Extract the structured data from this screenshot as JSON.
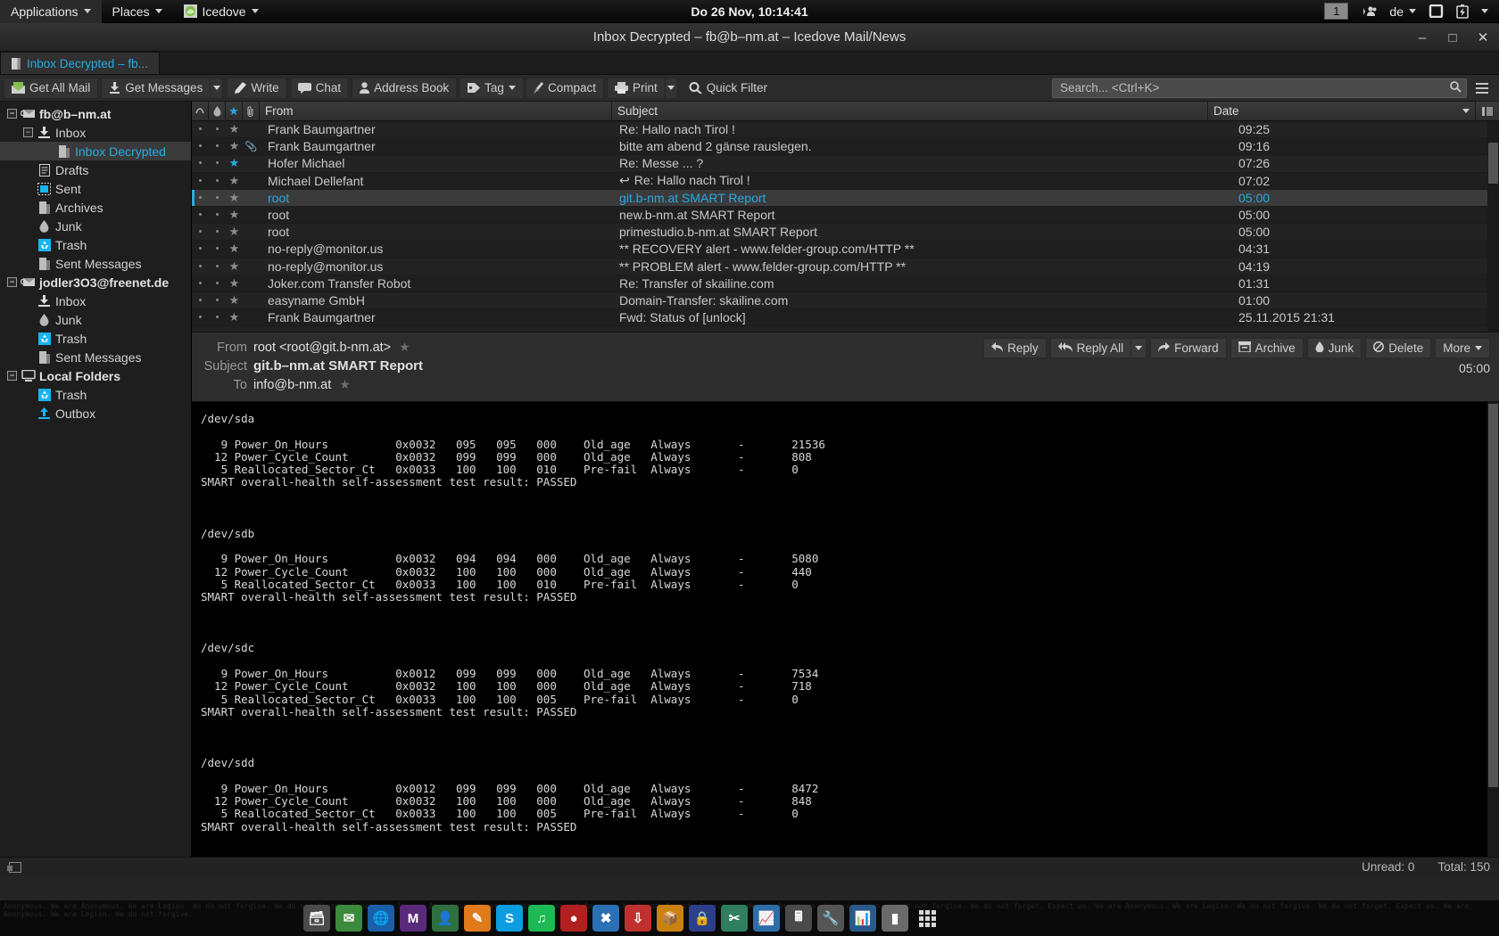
{
  "panel": {
    "applications": "Applications",
    "places": "Places",
    "app_name": "Icedove",
    "clock": "Do 26 Nov, 10:14:41",
    "workspace": "1",
    "keyboard": "de",
    "icons": [
      "users-icon",
      "keyboard-icon",
      "display-icon",
      "battery-icon"
    ]
  },
  "window": {
    "title": "Inbox Decrypted – fb@b–nm.at – Icedove Mail/News",
    "minimize": "–",
    "maximize": "□",
    "close": "✕"
  },
  "tab": {
    "label": "Inbox Decrypted – fb..."
  },
  "toolbar": {
    "get_all_mail": "Get All Mail",
    "get_messages": "Get Messages",
    "write": "Write",
    "chat": "Chat",
    "address_book": "Address Book",
    "tag": "Tag",
    "compact": "Compact",
    "print": "Print",
    "quick_filter": "Quick Filter",
    "search_placeholder": "Search... <Ctrl+K>",
    "search_value": ""
  },
  "sidebar": {
    "items": [
      {
        "label": "fb@b–nm.at",
        "level": 0,
        "icon": "account-icon",
        "twisty": "–",
        "account": true,
        "selected": false
      },
      {
        "label": "Inbox",
        "level": 1,
        "icon": "inbox-icon",
        "twisty": "–",
        "account": false,
        "selected": false
      },
      {
        "label": "Inbox Decrypted",
        "level": 2,
        "icon": "folder-icon",
        "twisty": "",
        "account": false,
        "selected": true
      },
      {
        "label": "Drafts",
        "level": 1,
        "icon": "drafts-icon",
        "twisty": "",
        "account": false,
        "selected": false
      },
      {
        "label": "Sent",
        "level": 1,
        "icon": "sent-icon",
        "twisty": "",
        "account": false,
        "selected": false
      },
      {
        "label": "Archives",
        "level": 1,
        "icon": "folder-icon",
        "twisty": "",
        "account": false,
        "selected": false
      },
      {
        "label": "Junk",
        "level": 1,
        "icon": "junk-icon",
        "twisty": "",
        "account": false,
        "selected": false
      },
      {
        "label": "Trash",
        "level": 1,
        "icon": "trash-icon",
        "twisty": "",
        "account": false,
        "selected": false
      },
      {
        "label": "Sent Messages",
        "level": 1,
        "icon": "folder-icon",
        "twisty": "",
        "account": false,
        "selected": false
      },
      {
        "label": "jodler3O3@freenet.de",
        "level": 0,
        "icon": "account-icon",
        "twisty": "–",
        "account": true,
        "selected": false
      },
      {
        "label": "Inbox",
        "level": 1,
        "icon": "inbox-icon",
        "twisty": "",
        "account": false,
        "selected": false
      },
      {
        "label": "Junk",
        "level": 1,
        "icon": "junk-icon",
        "twisty": "",
        "account": false,
        "selected": false
      },
      {
        "label": "Trash",
        "level": 1,
        "icon": "trash-icon",
        "twisty": "",
        "account": false,
        "selected": false
      },
      {
        "label": "Sent Messages",
        "level": 1,
        "icon": "folder-icon",
        "twisty": "",
        "account": false,
        "selected": false
      },
      {
        "label": "Local Folders",
        "level": 0,
        "icon": "local-folders-icon",
        "twisty": "–",
        "account": true,
        "selected": false
      },
      {
        "label": "Trash",
        "level": 1,
        "icon": "trash-icon",
        "twisty": "",
        "account": false,
        "selected": false
      },
      {
        "label": "Outbox",
        "level": 1,
        "icon": "outbox-icon",
        "twisty": "",
        "account": false,
        "selected": false
      }
    ]
  },
  "threadpane": {
    "columns": {
      "thread": "∞",
      "junk": "junk-icon",
      "star": "star-icon",
      "attach": "attachment-icon",
      "from": "From",
      "subject": "Subject",
      "date": "Date"
    },
    "rows": [
      {
        "from": "Frank Baumgartner",
        "subject": "Re: Hallo nach Tirol !",
        "date": "09:25",
        "star_on": false,
        "attach": false,
        "replied": false,
        "selected": false
      },
      {
        "from": "Frank Baumgartner",
        "subject": "bitte am abend 2 gänse rauslegen.",
        "date": "09:16",
        "star_on": false,
        "attach": true,
        "replied": false,
        "selected": false
      },
      {
        "from": "Hofer Michael",
        "subject": "Re: Messe ... ?",
        "date": "07:26",
        "star_on": true,
        "attach": false,
        "replied": false,
        "selected": false
      },
      {
        "from": "Michael Dellefant",
        "subject": "Re: Hallo nach Tirol !",
        "date": "07:02",
        "star_on": false,
        "attach": false,
        "replied": true,
        "selected": false
      },
      {
        "from": "root",
        "subject": "git.b-nm.at SMART Report",
        "date": "05:00",
        "star_on": false,
        "attach": false,
        "replied": false,
        "selected": true
      },
      {
        "from": "root",
        "subject": "new.b-nm.at SMART Report",
        "date": "05:00",
        "star_on": false,
        "attach": false,
        "replied": false,
        "selected": false
      },
      {
        "from": "root",
        "subject": "primestudio.b-nm.at SMART Report",
        "date": "05:00",
        "star_on": false,
        "attach": false,
        "replied": false,
        "selected": false
      },
      {
        "from": "no-reply@monitor.us",
        "subject": "** RECOVERY alert - www.felder-group.com/HTTP **",
        "date": "04:31",
        "star_on": false,
        "attach": false,
        "replied": false,
        "selected": false
      },
      {
        "from": "no-reply@monitor.us",
        "subject": "** PROBLEM alert - www.felder-group.com/HTTP **",
        "date": "04:19",
        "star_on": false,
        "attach": false,
        "replied": false,
        "selected": false
      },
      {
        "from": "Joker.com Transfer Robot",
        "subject": "Re: Transfer of skailine.com",
        "date": "01:31",
        "star_on": false,
        "attach": false,
        "replied": false,
        "selected": false
      },
      {
        "from": "easyname GmbH",
        "subject": "Domain-Transfer: skailine.com",
        "date": "01:00",
        "star_on": false,
        "attach": false,
        "replied": false,
        "selected": false
      },
      {
        "from": "Frank Baumgartner",
        "subject": "Fwd: Status of [unlock]",
        "date": "25.11.2015 21:31",
        "star_on": false,
        "attach": false,
        "replied": false,
        "selected": false
      }
    ]
  },
  "message": {
    "from_label": "From",
    "from_value": "root <root@git.b-nm.at>",
    "subject_label": "Subject",
    "subject_value": "git.b–nm.at SMART Report",
    "to_label": "To",
    "to_value": "info@b-nm.at",
    "time": "05:00",
    "actions": [
      {
        "label": "Reply",
        "icon": "reply-icon",
        "split": false
      },
      {
        "label": "Reply All",
        "icon": "reply-all-icon",
        "split": true
      },
      {
        "label": "Forward",
        "icon": "forward-icon",
        "split": false
      },
      {
        "label": "Archive",
        "icon": "archive-icon",
        "split": false
      },
      {
        "label": "Junk",
        "icon": "junk-icon",
        "split": false
      },
      {
        "label": "Delete",
        "icon": "delete-icon",
        "split": false
      },
      {
        "label": "More",
        "icon": "",
        "split": true
      }
    ],
    "body": "/dev/sda\n\n   9 Power_On_Hours          0x0032   095   095   000    Old_age   Always       -       21536\n  12 Power_Cycle_Count       0x0032   099   099   000    Old_age   Always       -       808\n   5 Reallocated_Sector_Ct   0x0033   100   100   010    Pre-fail  Always       -       0\nSMART overall-health self-assessment test result: PASSED\n\n\n\n/dev/sdb\n\n   9 Power_On_Hours          0x0032   094   094   000    Old_age   Always       -       5080\n  12 Power_Cycle_Count       0x0032   100   100   000    Old_age   Always       -       440\n   5 Reallocated_Sector_Ct   0x0033   100   100   010    Pre-fail  Always       -       0\nSMART overall-health self-assessment test result: PASSED\n\n\n\n/dev/sdc\n\n   9 Power_On_Hours          0x0012   099   099   000    Old_age   Always       -       7534\n  12 Power_Cycle_Count       0x0032   100   100   000    Old_age   Always       -       718\n   5 Reallocated_Sector_Ct   0x0033   100   100   005    Pre-fail  Always       -       0\nSMART overall-health self-assessment test result: PASSED\n\n\n\n/dev/sdd\n\n   9 Power_On_Hours          0x0012   099   099   000    Old_age   Always       -       8472\n  12 Power_Cycle_Count       0x0032   100   100   000    Old_age   Always       -       848\n   5 Reallocated_Sector_Ct   0x0033   100   100   005    Pre-fail  Always       -       0\nSMART overall-health self-assessment test result: PASSED"
  },
  "statusbar": {
    "unread": "Unread: 0",
    "total": "Total: 150"
  },
  "colors": {
    "accent": "#27aae1",
    "window_bg": "#242424",
    "body_bg": "#000000",
    "panel_bg": "#111111"
  }
}
